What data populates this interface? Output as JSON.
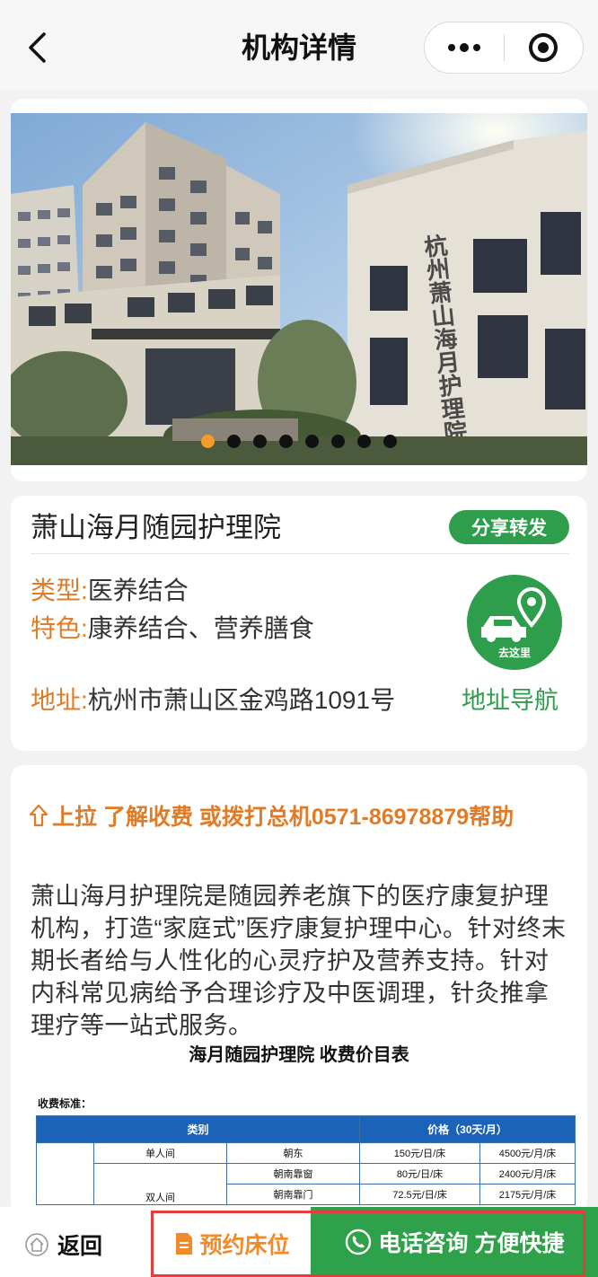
{
  "nav": {
    "title": "机构详情"
  },
  "hero": {
    "slide_count": 8,
    "active_index": 0,
    "sign_text": "杭州萧山海月护理院"
  },
  "institution": {
    "name": "萧山海月随园护理院",
    "share_label": "分享转发",
    "type_label": "类型:",
    "type_value": "医养结合",
    "feature_label": "特色:",
    "feature_value": "康养结合、营养膳食",
    "address_label": "地址:",
    "address_value": "杭州市萧山区金鸡路1091号",
    "goto_label": "去这里",
    "navigate_label": "地址导航"
  },
  "description": {
    "fee_hint": "上拉 了解收费 或拨打总机0571-86978879帮助",
    "text": "萧山海月护理院是随园养老旗下的医疗康复护理机构，打造“家庭式”医疗康复护理中心。针对终末期长者给与人性化的心灵疗护及营养支持。针对内科常见病给予合理诊疗及中医调理，针灸推拿理疗等一站式服务。",
    "price_table_title": "海月随园护理院 收费价目表",
    "price_standard_label": "收费标准：",
    "price_headers": [
      "类别",
      "价格（30天/月）"
    ],
    "price_rows": [
      [
        "单人间",
        "朝东",
        "150元/日/床",
        "4500元/月/床"
      ],
      [
        "双人间",
        "朝南靠窗",
        "80元/日/床",
        "2400元/月/床"
      ],
      [
        "双人间",
        "朝南靠门",
        "72.5元/日/床",
        "2175元/月/床"
      ]
    ]
  },
  "bottom_bar": {
    "back_label": "返回",
    "reserve_label": "预约床位",
    "call_label": "电话咨询 方便快捷"
  },
  "colors": {
    "accent_orange": "#e07b28",
    "brand_green": "#2e9d4c",
    "highlight_red": "#e83b3b",
    "table_blue": "#1a63b8"
  }
}
